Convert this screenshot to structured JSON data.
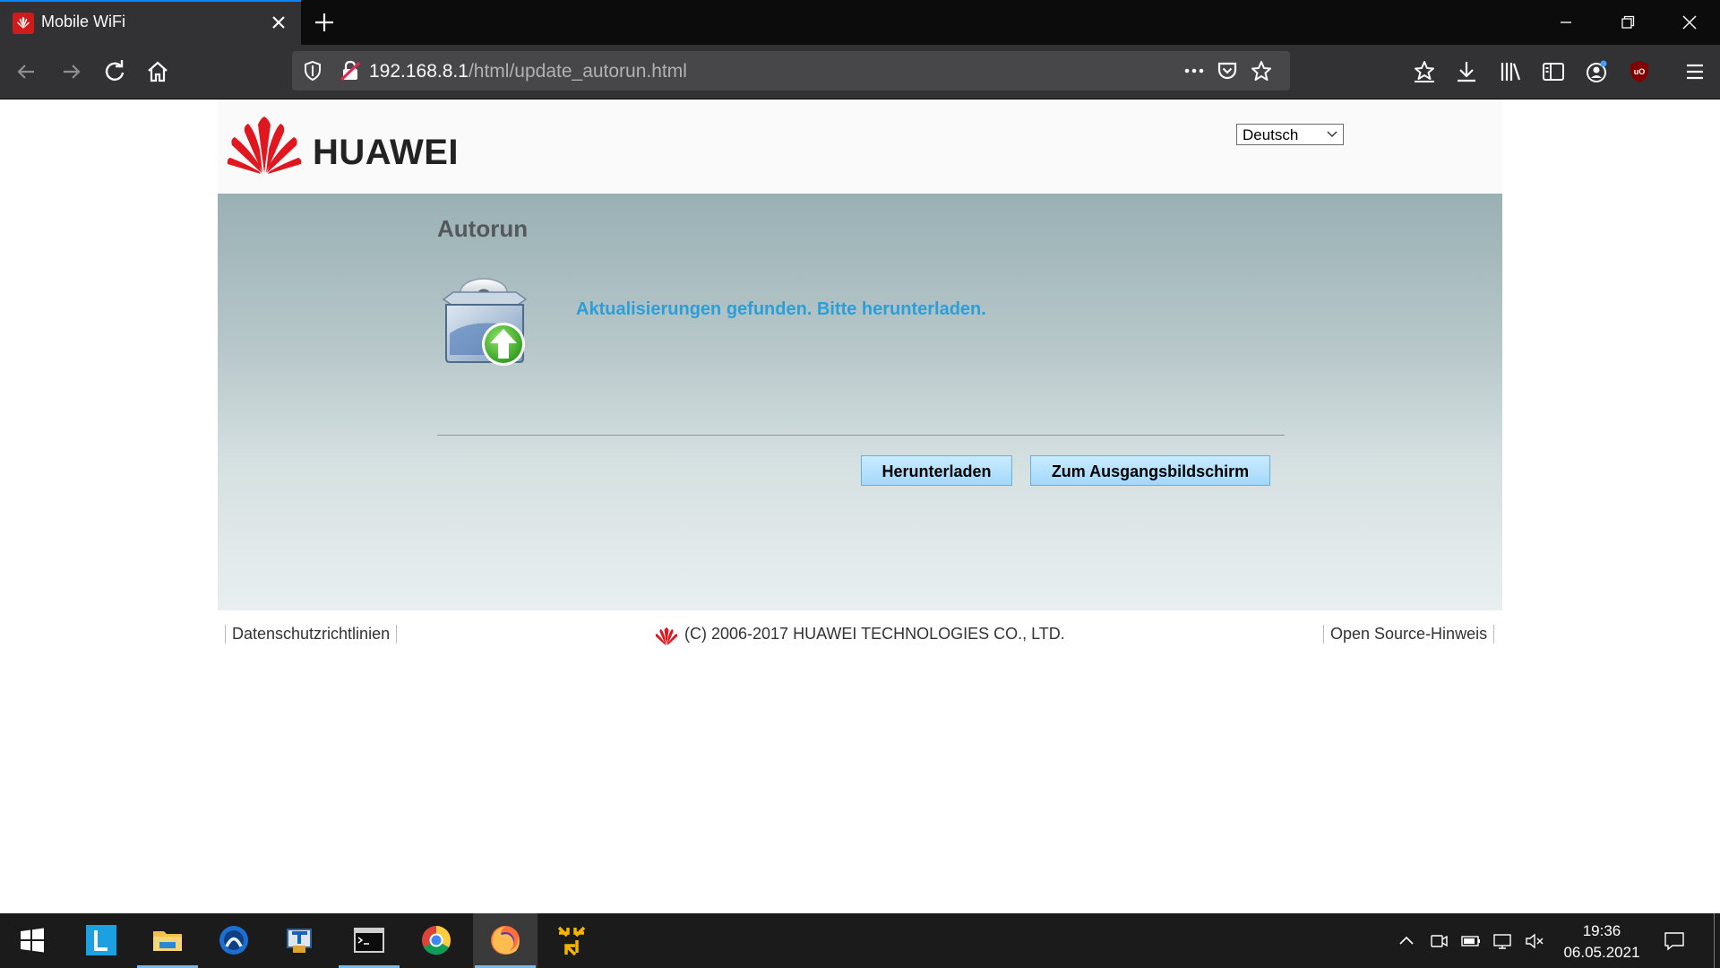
{
  "browser": {
    "tab_title": "Mobile WiFi",
    "url_host": "192.168.8.1",
    "url_path": "/html/update_autorun.html",
    "accent_color": "#0a84ff",
    "icons": [
      "back-arrow-icon",
      "forward-arrow-icon",
      "reload-icon",
      "home-icon",
      "shield-icon",
      "insecure-lock-icon",
      "more-icon",
      "pocket-icon",
      "bookmark-star-icon",
      "bookmarks-toolbar-icon",
      "download-icon",
      "library-icon",
      "sidebar-icon",
      "account-icon",
      "ublock-icon",
      "menu-icon"
    ]
  },
  "page": {
    "brand": "HUAWEI",
    "language_selected": "Deutsch",
    "title": "Autorun",
    "message": "Aktualisierungen gefunden. Bitte herunterladen.",
    "message_color": "#2a9fd8",
    "buttons": {
      "download": "Herunterladen",
      "home": "Zum Ausgangsbildschirm"
    },
    "footer": {
      "privacy": "Datenschutzrichtlinien",
      "copyright": "(C) 2006-2017 HUAWEI TECHNOLOGIES CO., LTD.",
      "open_source": "Open Source-Hinweis"
    }
  },
  "taskbar": {
    "time": "19:36",
    "date": "06.05.2021",
    "apps": [
      "windows-start-icon",
      "l-app-icon",
      "file-explorer-icon",
      "blue-circle-app-icon",
      "remote-app-icon",
      "terminal-icon",
      "chrome-icon",
      "firefox-icon",
      "yellow-arrows-app-icon"
    ]
  }
}
